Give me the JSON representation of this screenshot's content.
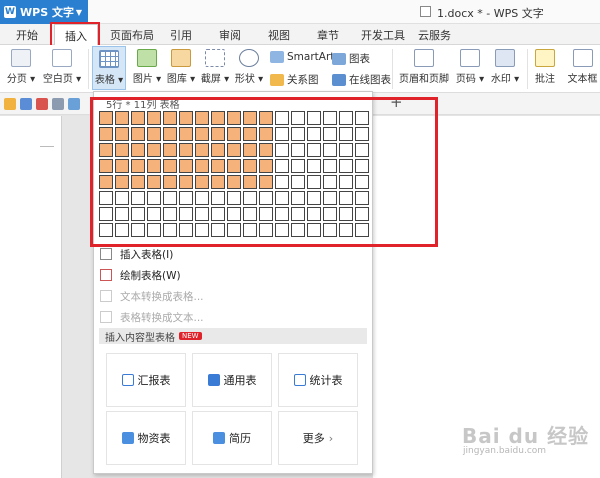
{
  "app": {
    "name": "WPS 文字",
    "doc_title": "1.docx * - WPS 文字"
  },
  "tabs": [
    "开始",
    "插入",
    "页面布局",
    "引用",
    "审阅",
    "视图",
    "章节",
    "开发工具",
    "云服务"
  ],
  "active_tab": "插入",
  "ribbon": {
    "page_break": "分页",
    "blank_page": "空白页",
    "table": "表格",
    "picture": "图片",
    "gallery": "图库",
    "screenshot": "截屏",
    "shape": "形状",
    "smartart": "SmartArt",
    "chart": "图表",
    "relation_chart": "关系图",
    "online_chart": "在线图表",
    "header_footer": "页眉和页脚",
    "page_number": "页码",
    "watermark": "水印",
    "comment": "批注",
    "textbox": "文本框"
  },
  "table_grid": {
    "caption": "5行 * 11列 表格",
    "rows_total": 8,
    "cols_total": 17,
    "rows_selected": 5,
    "cols_selected": 11
  },
  "menu": {
    "insert_table": "插入表格(I)",
    "draw_table": "绘制表格(W)",
    "text_to_table": "文本转换成表格...",
    "table_to_text": "表格转换成文本...",
    "section_title": "插入内容型表格",
    "badge": "NEW"
  },
  "cards": {
    "report": "汇报表",
    "general": "通用表",
    "stats": "统计表",
    "materials": "物资表",
    "resume": "简历",
    "more": "更多"
  },
  "watermark": {
    "main": "Bai du 经验",
    "sub": "jingyan.baidu.com"
  },
  "colors": {
    "accent": "#2b7fd1",
    "highlight_cell": "#f5b27a",
    "annotation_red": "#e0232a"
  }
}
